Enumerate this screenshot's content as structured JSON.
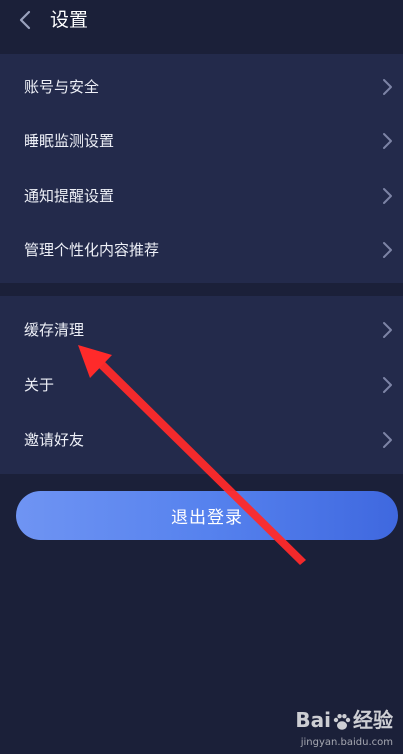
{
  "header": {
    "title": "设置",
    "back_icon": "chevron-left-icon"
  },
  "groups": [
    {
      "items": [
        {
          "label": "账号与安全"
        },
        {
          "label": "睡眠监测设置"
        },
        {
          "label": "通知提醒设置"
        },
        {
          "label": "管理个性化内容推荐"
        }
      ]
    },
    {
      "items": [
        {
          "label": "缓存清理"
        },
        {
          "label": "关于"
        },
        {
          "label": "邀请好友"
        }
      ]
    }
  ],
  "logout": {
    "label": "退出登录"
  },
  "watermark": {
    "brand_left": "Bai",
    "brand_right": "经验",
    "url": "jingyan.baidu.com"
  },
  "colors": {
    "background": "#1b2039",
    "group_background": "#232a4b",
    "chevron": "#7d84a6",
    "button_gradient_start": "#6f94f3",
    "button_gradient_end": "#3f68df",
    "annotation_arrow": "#ff2a2a"
  }
}
